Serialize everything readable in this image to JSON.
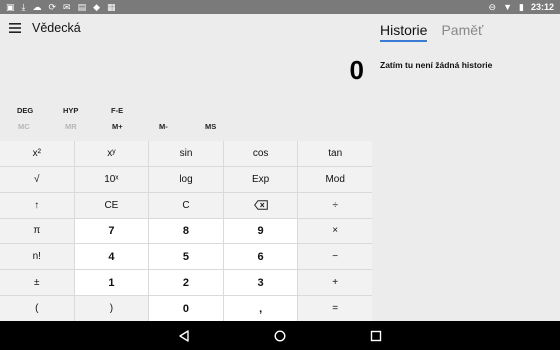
{
  "status_bar": {
    "time": "23:12",
    "left_icons": [
      "image-icon",
      "download-icon",
      "cloud-icon",
      "sync-icon",
      "mail-icon",
      "store-icon",
      "game-icon",
      "bag-icon"
    ],
    "right_icons": [
      "dnd-icon",
      "wifi-icon",
      "battery-icon"
    ]
  },
  "header": {
    "title": "Vědecká"
  },
  "display": {
    "value": "0"
  },
  "modes": {
    "deg": "DEG",
    "hyp": "HYP",
    "fe": "F-E"
  },
  "memory": {
    "mc": "MC",
    "mr": "MR",
    "mplus": "M+",
    "mminus": "M-",
    "ms": "MS"
  },
  "keys": {
    "r1": [
      "x²",
      "xʸ",
      "sin",
      "cos",
      "tan"
    ],
    "r2": [
      "√",
      "10ˣ",
      "log",
      "Exp",
      "Mod"
    ],
    "r3": [
      "↑",
      "CE",
      "C",
      "",
      "÷"
    ],
    "r4": [
      "π",
      "7",
      "8",
      "9",
      "×"
    ],
    "r5": [
      "n!",
      "4",
      "5",
      "6",
      "−"
    ],
    "r6": [
      "±",
      "1",
      "2",
      "3",
      "+"
    ],
    "r7": [
      "(",
      ")",
      "0",
      ",",
      "="
    ]
  },
  "history_panel": {
    "tab_history": "Historie",
    "tab_memory": "Paměť",
    "empty_text": "Zatím tu není žádná historie"
  },
  "colors": {
    "accent": "#3a7bd5",
    "status_bar": "#7a7a7a",
    "nav_bar": "#000000",
    "background": "#ececec"
  }
}
